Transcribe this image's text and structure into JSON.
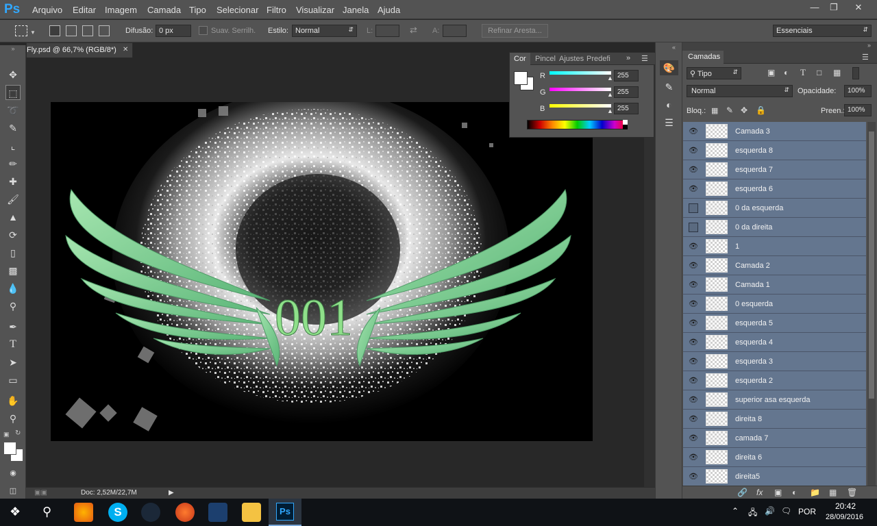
{
  "app": {
    "logo": "Ps"
  },
  "menu": [
    "Arquivo",
    "Editar",
    "Imagem",
    "Camada",
    "Tipo",
    "Selecionar",
    "Filtro",
    "Visualizar",
    "Janela",
    "Ajuda"
  ],
  "options_bar": {
    "feather_label": "Difusão:",
    "feather_value": "0 px",
    "antialias_label": "Suav. Serrilh.",
    "style_label": "Estilo:",
    "style_value": "Normal",
    "width_label": "L:",
    "height_label": "A:",
    "refine_edge_button": "Refinar Aresta...",
    "workspace_value": "Essenciais"
  },
  "document": {
    "tab_title": "Fly.psd @ 66,7% (RGB/8*)",
    "status": "Doc: 2,52M/22,7M",
    "artwork_text": "001"
  },
  "color_panel": {
    "tabs": [
      "Cor",
      "Pincel",
      "Ajustes",
      "Predefi"
    ],
    "channels": [
      {
        "label": "R",
        "value": "255",
        "gradient": "#00ffff,#ffffff"
      },
      {
        "label": "G",
        "value": "255",
        "gradient": "#ff00ff,#ffffff"
      },
      {
        "label": "B",
        "value": "255",
        "gradient": "#ffff00,#ffffff"
      }
    ]
  },
  "layers_panel": {
    "title": "Camadas",
    "filter_value": "Tipo",
    "blend_mode": "Normal",
    "opacity_label": "Opacidade:",
    "opacity_value": "100%",
    "lock_label": "Bloq.:",
    "fill_label": "Preen.:",
    "fill_value": "100%",
    "layers": [
      {
        "name": "Camada 3",
        "visible": true
      },
      {
        "name": "esquerda 8",
        "visible": true
      },
      {
        "name": "esquerda 7",
        "visible": true
      },
      {
        "name": "esquerda 6",
        "visible": true
      },
      {
        "name": "0 da esquerda",
        "visible": false
      },
      {
        "name": "0 da direita",
        "visible": false
      },
      {
        "name": "1",
        "visible": true
      },
      {
        "name": "Camada 2",
        "visible": true
      },
      {
        "name": "Camada 1",
        "visible": true
      },
      {
        "name": "0 esquerda",
        "visible": true
      },
      {
        "name": "esquerda 5",
        "visible": true
      },
      {
        "name": "esquerda 4",
        "visible": true
      },
      {
        "name": "esquerda 3",
        "visible": true
      },
      {
        "name": "esquerda 2",
        "visible": true
      },
      {
        "name": "superior asa esquerda",
        "visible": true
      },
      {
        "name": "direita 8",
        "visible": true
      },
      {
        "name": "camada 7",
        "visible": true
      },
      {
        "name": "direita 6",
        "visible": true
      },
      {
        "name": "direita5",
        "visible": true
      }
    ]
  },
  "taskbar": {
    "language": "POR",
    "time": "20:42",
    "date": "28/09/2016"
  },
  "colors": {
    "ui_gray": "#535353",
    "selected_layer": "#64768f",
    "ps_blue": "#31a8ff",
    "wing_green": "#7ccf8f"
  }
}
